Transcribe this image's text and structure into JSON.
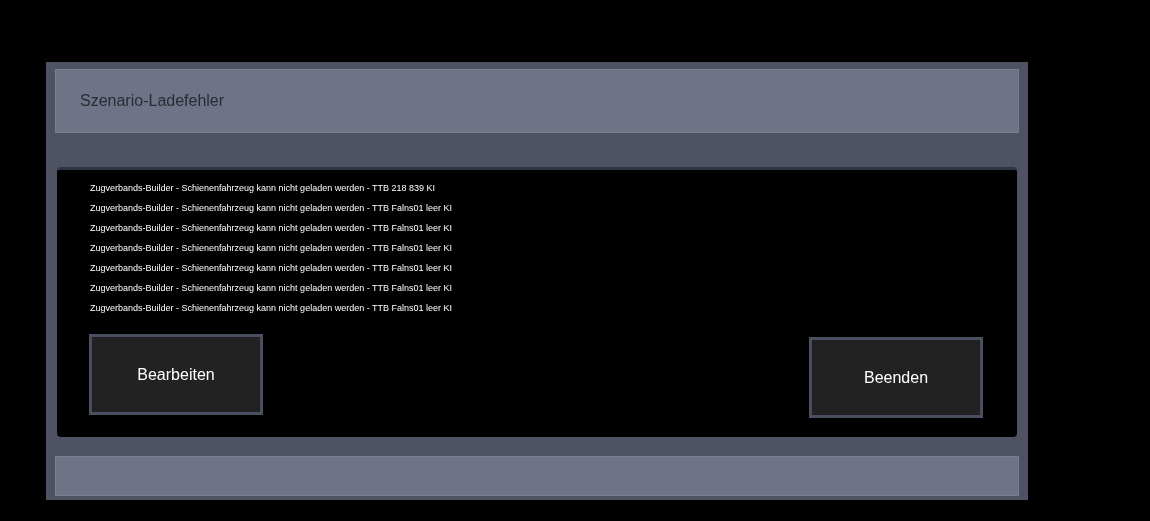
{
  "dialog": {
    "title": "Szenario-Ladefehler",
    "messages": [
      "Zugverbands-Builder - Schienenfahrzeug kann nicht geladen werden - TTB 218 839 KI",
      "Zugverbands-Builder - Schienenfahrzeug kann nicht geladen werden - TTB Falns01 leer KI",
      "Zugverbands-Builder - Schienenfahrzeug kann nicht geladen werden - TTB Falns01 leer KI",
      "Zugverbands-Builder - Schienenfahrzeug kann nicht geladen werden - TTB Falns01 leer KI",
      "Zugverbands-Builder - Schienenfahrzeug kann nicht geladen werden - TTB Falns01 leer KI",
      "Zugverbands-Builder - Schienenfahrzeug kann nicht geladen werden - TTB Falns01 leer KI",
      "Zugverbands-Builder - Schienenfahrzeug kann nicht geladen werden - TTB Falns01 leer KI"
    ],
    "buttons": [
      "Bearbeiten",
      "Beenden"
    ]
  }
}
